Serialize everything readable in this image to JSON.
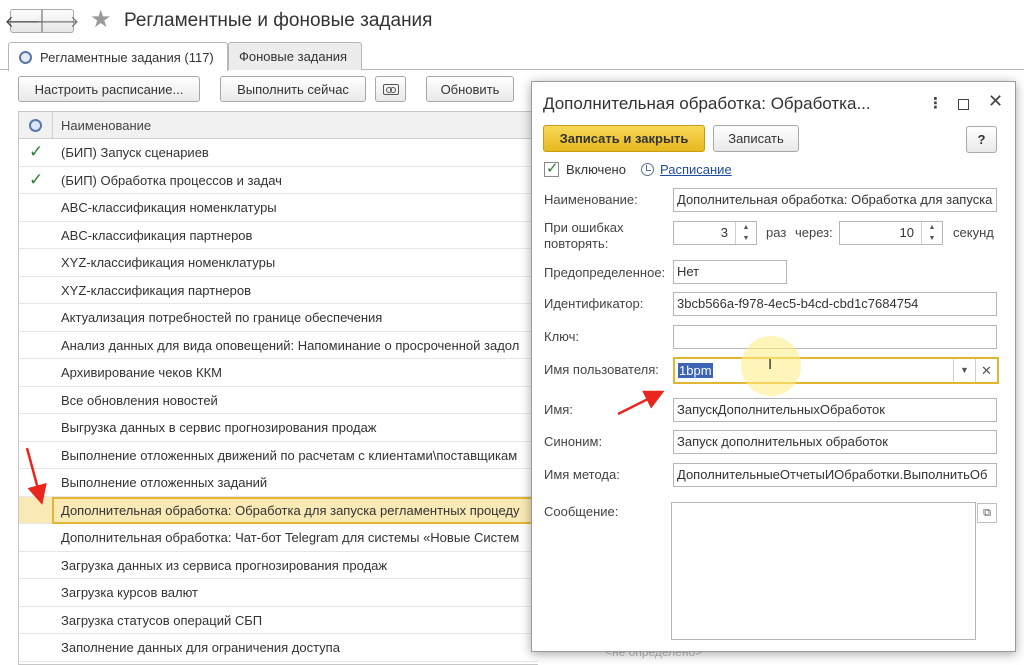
{
  "window": {
    "back_glyph": "🡐",
    "forward_glyph": "🡒",
    "title": "Регламентные и фоновые задания",
    "tabs": [
      {
        "label": "Регламентные задания (117)"
      },
      {
        "label": "Фоновые задания"
      }
    ]
  },
  "toolbar": {
    "schedule_label": "Настроить расписание...",
    "run_now_label": "Выполнить сейчас",
    "refresh_label": "Обновить"
  },
  "grid": {
    "column_name": "Наименование",
    "rows": [
      {
        "name": "(БИП) Запуск сценариев",
        "check": "✓"
      },
      {
        "name": "(БИП) Обработка процессов и задач",
        "check": "✓"
      },
      {
        "name": "ABC-классификация номенклатуры",
        "check": ""
      },
      {
        "name": "ABC-классификация партнеров",
        "check": ""
      },
      {
        "name": "XYZ-классификация номенклатуры",
        "check": ""
      },
      {
        "name": "XYZ-классификация партнеров",
        "check": ""
      },
      {
        "name": "Актуализация потребностей по границе обеспечения",
        "check": ""
      },
      {
        "name": "Анализ данных для вида оповещений: Напоминание о просроченной задол",
        "check": ""
      },
      {
        "name": "Архивирование чеков ККМ",
        "check": ""
      },
      {
        "name": "Все обновления новостей",
        "check": ""
      },
      {
        "name": "Выгрузка данных в сервис прогнозирования продаж",
        "check": ""
      },
      {
        "name": "Выполнение отложенных движений по расчетам с клиентами\\поставщикам",
        "check": ""
      },
      {
        "name": "Выполнение отложенных заданий",
        "check": ""
      },
      {
        "name": "Дополнительная обработка: Обработка для запуска регламентных процеду",
        "check": ""
      },
      {
        "name": "Дополнительная обработка: Чат-бот Telegram для системы «Новые Систем",
        "check": ""
      },
      {
        "name": "Загрузка данных из сервиса прогнозирования продаж",
        "check": ""
      },
      {
        "name": "Загрузка курсов валют",
        "check": ""
      },
      {
        "name": "Загрузка статусов операций СБП",
        "check": ""
      },
      {
        "name": "Заполнение данных для ограничения доступа",
        "check": ""
      }
    ],
    "faded_text": "<не определено>"
  },
  "dialog": {
    "title": "Дополнительная обработка: Обработка...",
    "more_glyph": "⋮",
    "close_glyph": "✕",
    "save_close_label": "Записать и закрыть",
    "save_label": "Записать",
    "help_label": "?",
    "enabled_label": "Включено",
    "enabled_check": "✓",
    "schedule_link": "Расписание",
    "name_label": "Наименование:",
    "name_value": "Дополнительная обработка: Обработка для запуска",
    "retry_label_1": "При ошибках",
    "retry_label_2": "повторять:",
    "retry_count": "3",
    "times_label": "раз",
    "after_label": "через:",
    "retry_interval": "10",
    "seconds_label": "секунд",
    "spin_up": "▲",
    "spin_down": "▼",
    "predefined_label": "Предопределенное:",
    "predefined_value": "Нет",
    "id_label": "Идентификатор:",
    "id_value": "3bcb566a-f978-4ec5-b4cd-cbd1c7684754",
    "key_label": "Ключ:",
    "key_value": "",
    "user_label": "Имя пользователя:",
    "user_value": "1bpm",
    "dropdown_glyph": "▼",
    "clear_glyph": "✕",
    "imya_label": "Имя:",
    "imya_value": "ЗапускДополнительныхОбработок",
    "synonym_label": "Синоним:",
    "synonym_value": "Запуск дополнительных обработок",
    "method_label": "Имя метода:",
    "method_value": "ДополнительныеОтчетыИОбработки.ВыполнитьОб",
    "message_label": "Сообщение:",
    "message_value": "",
    "message_open_glyph": "⧉"
  },
  "colors": {
    "accent": "#e7b81e",
    "selection": "#f9e9b5",
    "arrow": "#e8261e",
    "link": "#1c4d9e"
  }
}
